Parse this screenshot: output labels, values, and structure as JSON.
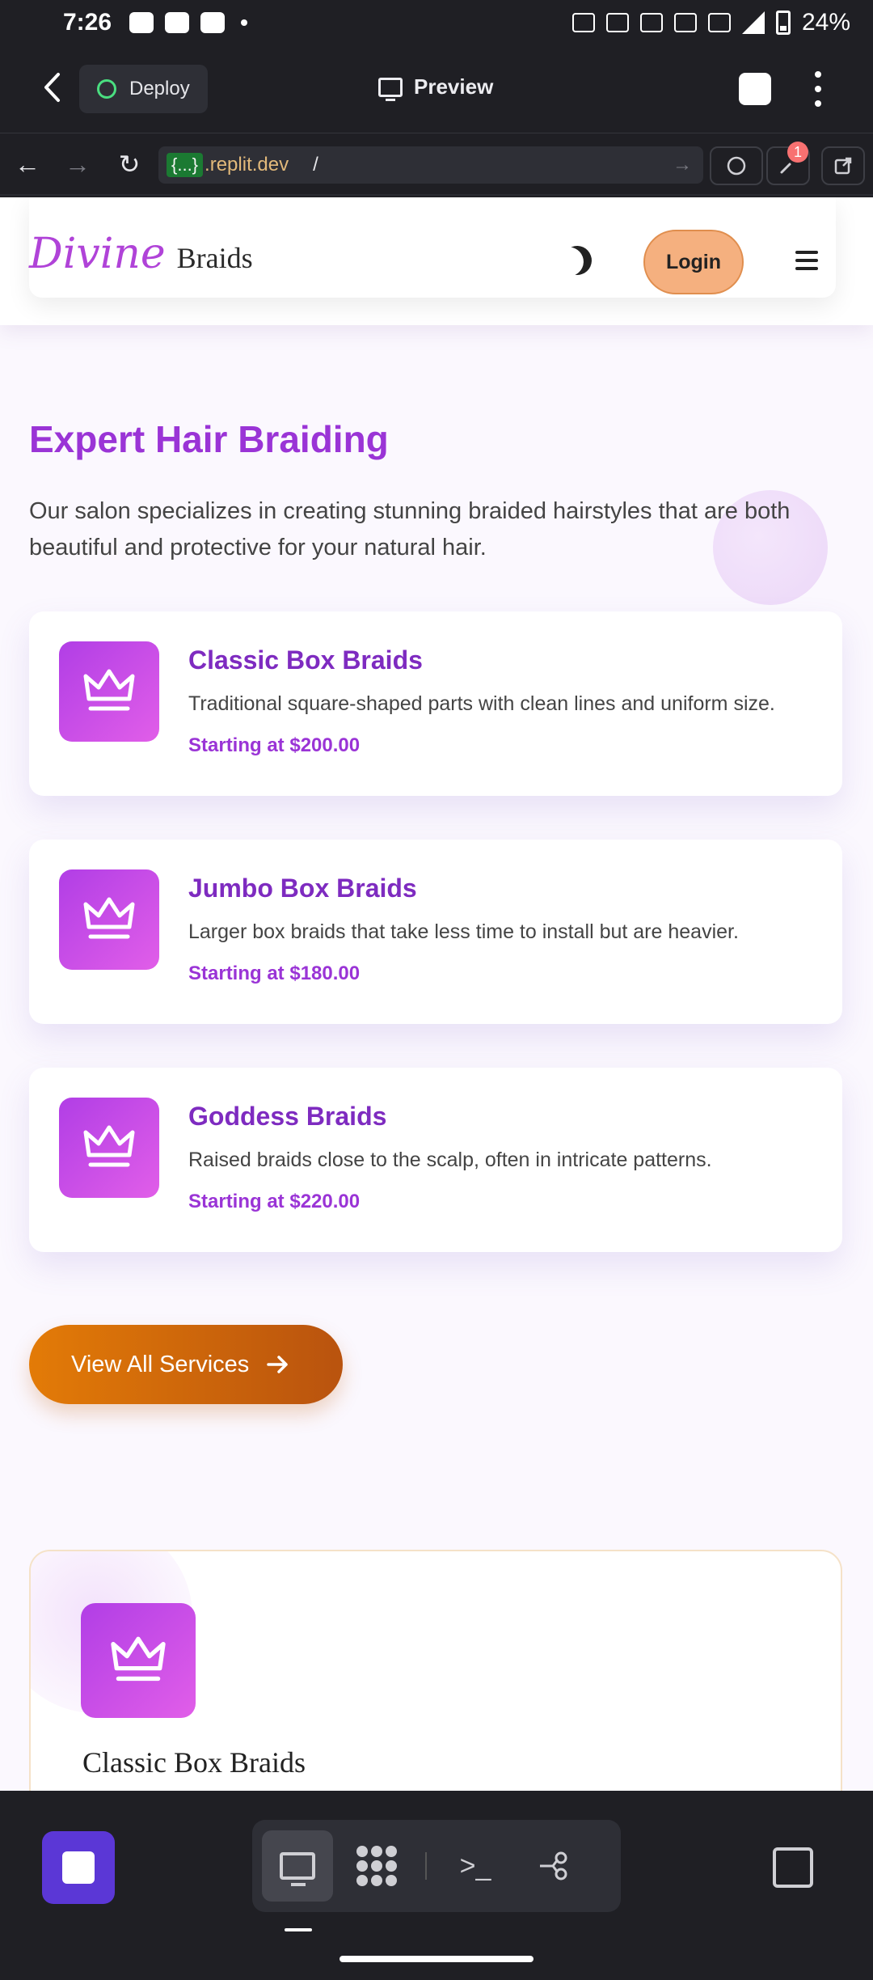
{
  "status_bar": {
    "time": "7:26",
    "battery": "24%"
  },
  "top_bar": {
    "deploy_label": "Deploy",
    "preview_label": "Preview"
  },
  "url_bar": {
    "tag": "{...}",
    "host": ".replit.dev",
    "path": "/",
    "notification_count": "1"
  },
  "site": {
    "logo_script": "Divine",
    "logo_word": "Braids",
    "login_label": "Login",
    "section_title": "Expert Hair Braiding",
    "section_description": "Our salon specializes in creating stunning braided hairstyles that are both beautiful and protective for your natural hair.",
    "services": [
      {
        "name": "Classic Box Braids",
        "description": "Traditional square-shaped parts with clean lines and uniform size.",
        "price": "Starting at $200.00"
      },
      {
        "name": "Jumbo Box Braids",
        "description": "Larger box braids that take less time to install but are heavier.",
        "price": "Starting at $180.00"
      },
      {
        "name": "Goddess Braids",
        "description": "Raised braids close to the scalp, often in intricate patterns.",
        "price": "Starting at $220.00"
      }
    ],
    "view_all_label": "View All Services",
    "featured_title": "Classic Box Braids"
  },
  "bottom_bar": {
    "console_glyph": ">_"
  },
  "colors": {
    "accent_purple": "#9a34d6",
    "login_orange": "#f5b07f",
    "cta_orange": "#e37b07",
    "replit_purple": "#5b37d6"
  }
}
